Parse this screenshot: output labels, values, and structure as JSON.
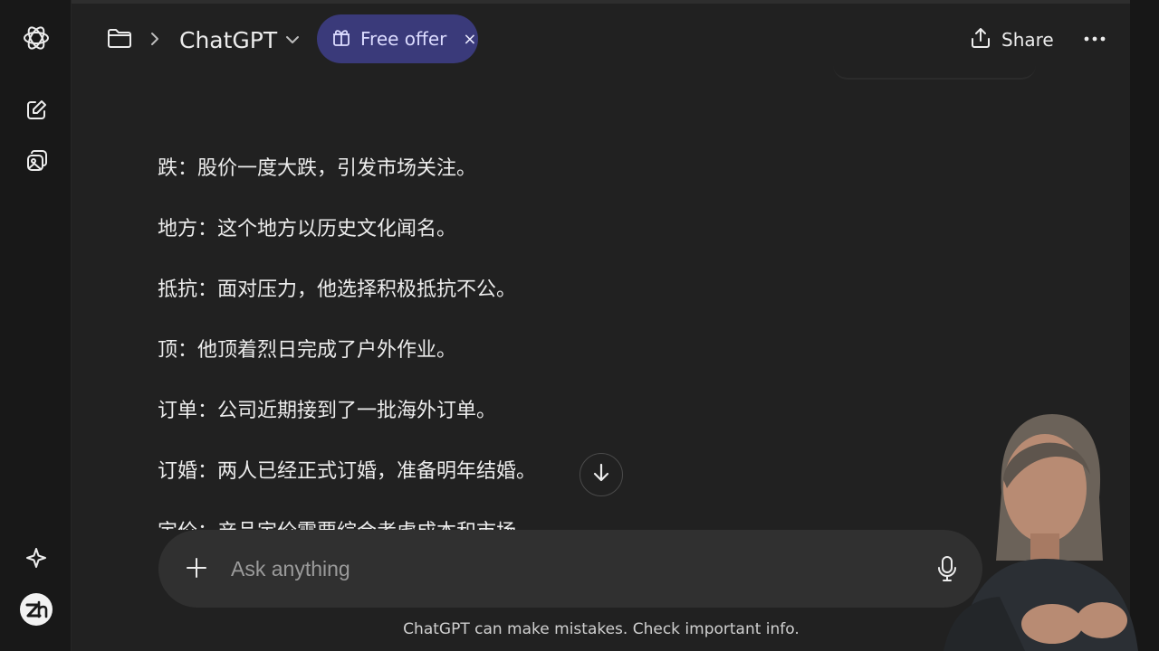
{
  "header": {
    "model_title": "ChatGPT",
    "offer_label": "Free offer",
    "offer_close": "×",
    "share_label": "Share"
  },
  "conversation": {
    "lines": [
      "跌：股价一度大跌，引发市场关注。",
      "地方：这个地方以历史文化闻名。",
      "抵抗：面对压力，他选择积极抵抗不公。",
      "顶：他顶着烈日完成了户外作业。",
      "订单：公司近期接到了一批海外订单。",
      "订婚：两人已经正式订婚，准备明年结婚。",
      "定价：产品定价需要综合考虑成本和市场。"
    ]
  },
  "composer": {
    "placeholder": "Ask anything"
  },
  "footer": {
    "disclaimer": "ChatGPT can make mistakes. Check important info."
  },
  "colors": {
    "background": "#212121",
    "rail": "#181818",
    "offer_pill": "#3a3a7a",
    "composer": "#303030",
    "text": "#ececec"
  },
  "icons": {
    "logo": "openai-logo-icon",
    "new_chat": "edit-icon",
    "library": "images-icon",
    "explore": "sparkle-icon",
    "folder": "folder-icon",
    "chevron": "chevron-right-icon",
    "model_menu": "chevron-down-icon",
    "offer": "gift-icon",
    "share": "share-icon",
    "more": "more-icon",
    "scroll": "arrow-down-icon",
    "attach": "plus-icon",
    "voice": "mic-icon"
  }
}
